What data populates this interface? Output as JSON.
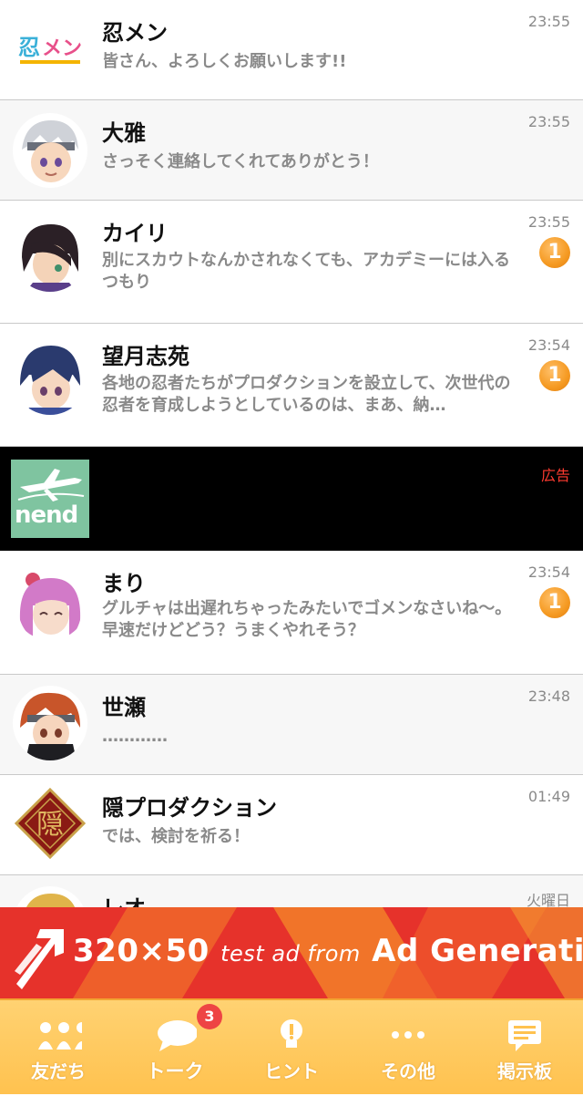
{
  "chats": [
    {
      "name": "忍メン",
      "message": "皆さん、よろしくお願いします!!",
      "time": "23:55",
      "badge": "",
      "avatar": "shinomen-logo-icon"
    },
    {
      "name": "大雅",
      "message": "さっそく連絡してくれてありがとう！",
      "time": "23:55",
      "badge": "",
      "avatar": "taiga-avatar"
    },
    {
      "name": "カイリ",
      "message": "別にスカウトなんかされなくても、アカデミーには入るつもり",
      "time": "23:55",
      "badge": "1",
      "avatar": "kairi-avatar"
    },
    {
      "name": "望月志苑",
      "message": "各地の忍者たちがプロダクションを設立して、次世代の忍者を育成しようとしているのは、まあ、納…",
      "time": "23:54",
      "badge": "1",
      "avatar": "mochizuki-avatar"
    },
    {
      "name": "まり",
      "message": "グルチャは出遅れちゃったみたいでゴメンなさいね〜。早速だけどどう？うまくやれそう？",
      "time": "23:54",
      "badge": "1",
      "avatar": "mari-avatar"
    },
    {
      "name": "世瀬",
      "message": "…………",
      "time": "23:48",
      "badge": "",
      "avatar": "seze-avatar"
    },
    {
      "name": "隠プロダクション",
      "message": "では、検討を祈る！",
      "time": "01:49",
      "badge": "",
      "avatar": "kakure-emblem-icon"
    },
    {
      "name": "レオ",
      "message": "",
      "time": "火曜日",
      "badge": "",
      "avatar": "leo-avatar"
    }
  ],
  "ad": {
    "label": "広告",
    "logo_text": "nend"
  },
  "banner": {
    "size": "320×50",
    "middle": "test ad from",
    "brand": "Ad Generation"
  },
  "tabs": [
    {
      "label": "友だち",
      "icon": "friends-icon"
    },
    {
      "label": "トーク",
      "icon": "talk-bubble-icon",
      "badge": "3"
    },
    {
      "label": "ヒント",
      "icon": "hint-bulb-icon"
    },
    {
      "label": "その他",
      "icon": "more-dots-icon"
    },
    {
      "label": "掲示板",
      "icon": "board-icon"
    }
  ],
  "colors": {
    "accent": "#f59a22",
    "tabbar": "#ffc24f",
    "ad_red": "#e8302a"
  }
}
